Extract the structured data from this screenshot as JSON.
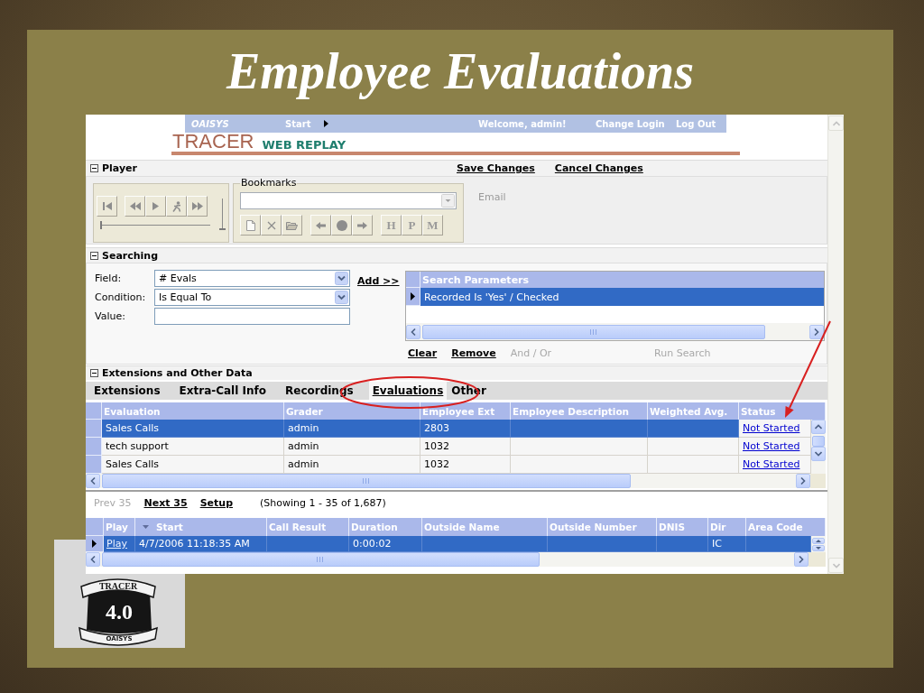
{
  "slide": {
    "title": "Employee Evaluations",
    "badge": {
      "banner": "TRACER",
      "version": "4.0",
      "maker": "OAISYS"
    }
  },
  "nav": {
    "brand": "OAISYS",
    "menu": "Start",
    "welcome": "Welcome, admin!",
    "links": [
      "Change Login",
      "Log Out"
    ]
  },
  "product": {
    "name": "TRACER",
    "edition": "WEB REPLAY"
  },
  "player": {
    "title": "Player",
    "expanded": true,
    "actions": [
      "Save Changes",
      "Cancel Changes"
    ],
    "seek": {
      "level": 0
    },
    "volume": {
      "level": 0
    },
    "bookmarks": {
      "label": "Bookmarks",
      "marker_buttons": [
        "H",
        "P",
        "M"
      ]
    },
    "email": {
      "label": "Email"
    }
  },
  "searching": {
    "title": "Searching",
    "expanded": true,
    "fields": [
      {
        "kind": "select",
        "label": "Field:",
        "value": "# Evals"
      },
      {
        "kind": "select",
        "label": "Condition:",
        "value": "Is Equal To"
      },
      {
        "kind": "text",
        "label": "Value:"
      }
    ],
    "add_link": "Add >>",
    "parameters": {
      "title": "Search Parameters",
      "rows": [
        {
          "text": "Recorded Is 'Yes' / Checked",
          "selected": true
        }
      ]
    },
    "actions": [
      {
        "label": "Clear",
        "disabled": false
      },
      {
        "label": "Remove",
        "disabled": false
      },
      {
        "label": "And / Or",
        "disabled": true
      },
      {
        "label": "Run Search",
        "disabled": true
      }
    ]
  },
  "extensions": {
    "title": "Extensions and Other Data",
    "expanded": true,
    "tabs": [
      {
        "label": "Extensions",
        "selected": false
      },
      {
        "label": "Extra-Call Info",
        "selected": false
      },
      {
        "label": "Recordings",
        "selected": false
      },
      {
        "label": "Evaluations",
        "selected": true
      },
      {
        "label": "Other",
        "selected": false
      }
    ],
    "evaluations": {
      "columns": [
        "Evaluation",
        "Grader",
        "Employee Ext",
        "Employee Description",
        "Weighted Avg.",
        "Status"
      ],
      "rows": [
        {
          "evaluation": "Sales Calls",
          "grader": "admin",
          "employee_ext": "2803",
          "status": "Not Started",
          "selected": true
        },
        {
          "evaluation": "tech support",
          "grader": "admin",
          "employee_ext": "1032",
          "status": "Not Started",
          "selected": false
        },
        {
          "evaluation": "Sales Calls",
          "grader": "admin",
          "employee_ext": "1032",
          "status": "Not Started",
          "selected": false
        }
      ]
    }
  },
  "recordings": {
    "pager": [
      {
        "label": "Prev 35",
        "disabled": true
      },
      {
        "label": "Next 35",
        "disabled": false
      },
      {
        "label": "Setup",
        "disabled": false
      }
    ],
    "summary": "(Showing 1 - 35 of 1,687)",
    "columns": [
      {
        "label": "Play",
        "sorted": false
      },
      {
        "label": "Start",
        "sorted": true
      },
      {
        "label": "Call Result",
        "sorted": false
      },
      {
        "label": "Duration",
        "sorted": false
      },
      {
        "label": "Outside Name",
        "sorted": false
      },
      {
        "label": "Outside Number",
        "sorted": false
      },
      {
        "label": "DNIS",
        "sorted": false
      },
      {
        "label": "Dir",
        "sorted": false
      },
      {
        "label": "Area Code",
        "sorted": false
      }
    ],
    "rows": [
      {
        "play": "Play",
        "start": "4/7/2006 11:18:35 AM",
        "duration": "0:00:02",
        "dir": "IC",
        "selected": true
      }
    ]
  }
}
